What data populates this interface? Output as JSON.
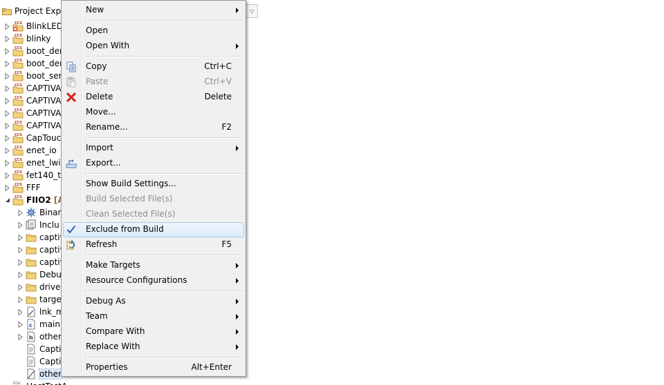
{
  "explorer": {
    "title": "Project Explo",
    "items": [
      {
        "label": "BlinkLED_",
        "icon": "ccs-project-error-icon",
        "twisty": "collapsed",
        "indent": 0
      },
      {
        "label": "blinky",
        "icon": "ccs-project-icon",
        "twisty": "collapsed",
        "indent": 0
      },
      {
        "label": "boot_den",
        "icon": "ccs-project-icon",
        "twisty": "collapsed",
        "indent": 0
      },
      {
        "label": "boot_den",
        "icon": "ccs-project-icon",
        "twisty": "collapsed",
        "indent": 0
      },
      {
        "label": "boot_seri",
        "icon": "ccs-project-icon",
        "twisty": "collapsed",
        "indent": 0
      },
      {
        "label": "CAPTIVA",
        "icon": "ccs-project-icon",
        "twisty": "collapsed",
        "indent": 0
      },
      {
        "label": "CAPTIVA",
        "icon": "ccs-project-icon",
        "twisty": "collapsed",
        "indent": 0
      },
      {
        "label": "CAPTIVA",
        "icon": "ccs-project-icon",
        "twisty": "collapsed",
        "indent": 0
      },
      {
        "label": "CAPTIVA",
        "icon": "ccs-project-icon",
        "twisty": "collapsed",
        "indent": 0
      },
      {
        "label": "CapTouc",
        "icon": "ccs-project-icon",
        "twisty": "collapsed",
        "indent": 0
      },
      {
        "label": "enet_io",
        "icon": "ccs-project-icon",
        "twisty": "collapsed",
        "indent": 0
      },
      {
        "label": "enet_lwip",
        "icon": "ccs-project-icon",
        "twisty": "collapsed",
        "indent": 0
      },
      {
        "label": "fet140_ta",
        "icon": "ccs-project-icon",
        "twisty": "collapsed",
        "indent": 0
      },
      {
        "label": "FFF",
        "icon": "ccs-project-icon",
        "twisty": "collapsed",
        "indent": 0
      },
      {
        "label": "FIIO2",
        "decoration": "[A",
        "icon": "ccs-project-icon",
        "twisty": "expanded",
        "indent": 0,
        "bold": true
      },
      {
        "label": "Binar",
        "icon": "binaries-icon",
        "twisty": "collapsed",
        "indent": 1
      },
      {
        "label": "Inclu",
        "icon": "includes-icon",
        "twisty": "collapsed",
        "indent": 1
      },
      {
        "label": "captiv",
        "icon": "folder-icon",
        "twisty": "collapsed",
        "indent": 1
      },
      {
        "label": "captiv",
        "icon": "folder-icon",
        "twisty": "collapsed",
        "indent": 1
      },
      {
        "label": "captiv",
        "icon": "folder-icon",
        "twisty": "collapsed",
        "indent": 1
      },
      {
        "label": "Debu",
        "icon": "folder-icon",
        "twisty": "collapsed",
        "indent": 1
      },
      {
        "label": "driver",
        "icon": "folder-icon",
        "twisty": "collapsed",
        "indent": 1
      },
      {
        "label": "target",
        "icon": "folder-icon",
        "twisty": "collapsed",
        "indent": 1
      },
      {
        "label": "lnk_m",
        "icon": "linker-file-icon",
        "twisty": "collapsed",
        "indent": 1
      },
      {
        "label": "main.",
        "icon": "c-file-icon",
        "twisty": "collapsed",
        "indent": 1
      },
      {
        "label": "other",
        "icon": "h-file-icon",
        "twisty": "collapsed",
        "indent": 1
      },
      {
        "label": "Captiv",
        "icon": "text-file-icon",
        "twisty": "none",
        "indent": 1
      },
      {
        "label": "Captiv",
        "icon": "text-file-icon",
        "twisty": "none",
        "indent": 1
      },
      {
        "label": "other",
        "icon": "excluded-file-icon",
        "twisty": "none",
        "indent": 1,
        "selected": true
      },
      {
        "label": "HostTestA",
        "icon": "rtsc-project-icon",
        "twisty": "none",
        "indent": 0
      }
    ]
  },
  "view_toolbar": {
    "icon": "chevron-down-icon",
    "glyph": "▽"
  },
  "context_menu": {
    "items": [
      {
        "type": "item",
        "label": "New",
        "submenu": true
      },
      {
        "type": "sep"
      },
      {
        "type": "item",
        "label": "Open"
      },
      {
        "type": "item",
        "label": "Open With",
        "submenu": true
      },
      {
        "type": "sep"
      },
      {
        "type": "item",
        "label": "Copy",
        "accel": "Ctrl+C",
        "icon": "copy-icon"
      },
      {
        "type": "item",
        "label": "Paste",
        "accel": "Ctrl+V",
        "icon": "paste-icon",
        "disabled": true
      },
      {
        "type": "item",
        "label": "Delete",
        "accel": "Delete",
        "icon": "delete-icon"
      },
      {
        "type": "item",
        "label": "Move..."
      },
      {
        "type": "item",
        "label": "Rename...",
        "accel": "F2"
      },
      {
        "type": "sep"
      },
      {
        "type": "item",
        "label": "Import",
        "submenu": true
      },
      {
        "type": "item",
        "label": "Export...",
        "icon": "export-icon"
      },
      {
        "type": "sep"
      },
      {
        "type": "item",
        "label": "Show Build Settings..."
      },
      {
        "type": "item",
        "label": "Build Selected File(s)",
        "disabled": true
      },
      {
        "type": "item",
        "label": "Clean Selected File(s)",
        "disabled": true
      },
      {
        "type": "item",
        "label": "Exclude from Build",
        "icon": "checkmark-icon",
        "checked": true,
        "highlighted": true
      },
      {
        "type": "item",
        "label": "Refresh",
        "accel": "F5",
        "icon": "refresh-icon"
      },
      {
        "type": "sep"
      },
      {
        "type": "item",
        "label": "Make Targets",
        "submenu": true
      },
      {
        "type": "item",
        "label": "Resource Configurations",
        "submenu": true
      },
      {
        "type": "sep"
      },
      {
        "type": "item",
        "label": "Debug As",
        "submenu": true
      },
      {
        "type": "item",
        "label": "Team",
        "submenu": true
      },
      {
        "type": "item",
        "label": "Compare With",
        "submenu": true
      },
      {
        "type": "item",
        "label": "Replace With",
        "submenu": true
      },
      {
        "type": "sep"
      },
      {
        "type": "item",
        "label": "Properties",
        "accel": "Alt+Enter"
      }
    ]
  },
  "colors": {
    "menu_bg": "#f0f0f0",
    "menu_border": "#979797",
    "highlight_border": "#a8c8ee",
    "disabled_text": "#8d8d8d",
    "check_blue": "#1d4fa8",
    "delete_red": "#d42a1e",
    "folder_yellow": "#e8c25a"
  }
}
